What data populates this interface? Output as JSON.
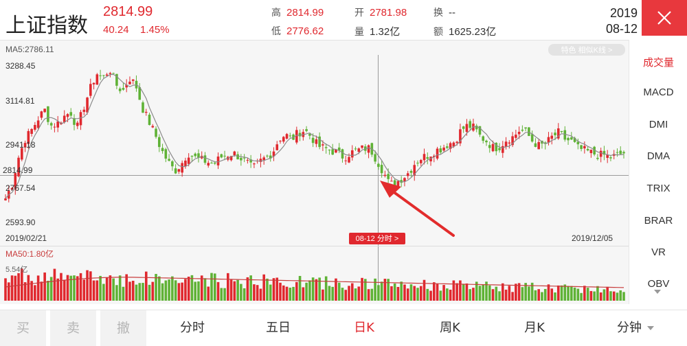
{
  "header": {
    "title": "上证指数",
    "price": "2814.99",
    "change": "40.24",
    "change_pct": "1.45%",
    "high_label": "高",
    "high": "2814.99",
    "low_label": "低",
    "low": "2776.62",
    "open_label": "开",
    "open": "2781.98",
    "volume_label": "量",
    "volume": "1.32亿",
    "turnover_label": "换",
    "turnover": "--",
    "amount_label": "额",
    "amount": "1625.23亿",
    "date_year": "2019",
    "date_md": "08-12"
  },
  "chart": {
    "ma5": "MA5:2786.11",
    "pill": "特色 相似K线 >",
    "y_labels": [
      "3288.45",
      "3114.81",
      "2941.18",
      "2814.99",
      "2767.54",
      "2593.90"
    ],
    "start_date": "2019/02/21",
    "end_date": "2019/12/05",
    "crosshair_label": "08-12 分时 >",
    "vol_ma": "MA50:1.80亿",
    "vol_axis_label": "5.54亿"
  },
  "chart_data": {
    "type": "candlestick",
    "x_range": [
      "2019/02/21",
      "2019/12/05"
    ],
    "ylim": [
      2593.9,
      3288.45
    ],
    "y_ticks": [
      3288.45,
      3114.81,
      2941.18,
      2767.54,
      2593.9
    ],
    "current_price": 2814.99,
    "selected_date": "08-12",
    "close_path": [
      2700,
      2760,
      2880,
      2960,
      3000,
      3050,
      3090,
      3020,
      3030,
      3060,
      3080,
      3010,
      3100,
      3180,
      3250,
      3230,
      3270,
      3200,
      3170,
      3230,
      3200,
      3100,
      3040,
      2980,
      2910,
      2860,
      2820,
      2850,
      2900,
      2880,
      2870,
      2860,
      2850,
      2880,
      2890,
      2900,
      2880,
      2860,
      2830,
      2860,
      2880,
      2900,
      2960,
      2980,
      2960,
      2990,
      3000,
      2970,
      2930,
      2920,
      2910,
      2900,
      2880,
      2900,
      2910,
      2920,
      2920,
      2870,
      2820,
      2760,
      2770,
      2790,
      2815,
      2860,
      2880,
      2890,
      2910,
      2920,
      2940,
      2950,
      3000,
      3020,
      3010,
      2970,
      2950,
      2920,
      2930,
      2960,
      2970,
      3000,
      2990,
      2950,
      2930,
      2940,
      2970,
      2990,
      2960,
      2950,
      2920,
      2910,
      2900,
      2890,
      2890,
      2880,
      2890,
      2900
    ],
    "volume_ma50": 1.8,
    "volume_max_label": 5.54
  },
  "side_menu": [
    "成交量",
    "MACD",
    "DMI",
    "DMA",
    "TRIX",
    "BRAR",
    "VR",
    "OBV"
  ],
  "bottom": {
    "buy": "买",
    "sell": "卖",
    "cancel": "撤",
    "tabs": [
      "分时",
      "五日",
      "日K",
      "周K",
      "月K",
      "分钟"
    ]
  },
  "colors": {
    "up": "#e0282e",
    "down": "#5fb236",
    "accent": "#e8383d",
    "ma": "#8a8a8a"
  }
}
